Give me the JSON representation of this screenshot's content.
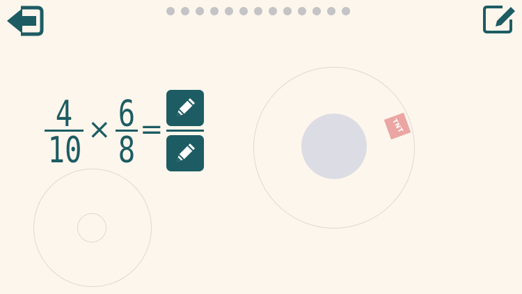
{
  "nav": {
    "back_icon": "exit-arrow-icon",
    "edit_icon": "edit-note-icon",
    "progress_dots": 13,
    "accent_color": "#1d5c63",
    "dot_color": "#c4c3c5",
    "background_color": "#fdf6ec"
  },
  "equation": {
    "fraction1": {
      "numerator": "4",
      "denominator": "10"
    },
    "operator": "×",
    "fraction2": {
      "numerator": "6",
      "denominator": "8"
    },
    "equals": "=",
    "answer_numerator_icon": "pencil-icon",
    "answer_denominator_icon": "pencil-icon"
  },
  "target": {
    "sticker_text": "TNT",
    "sticker_color": "#eba5a3"
  }
}
